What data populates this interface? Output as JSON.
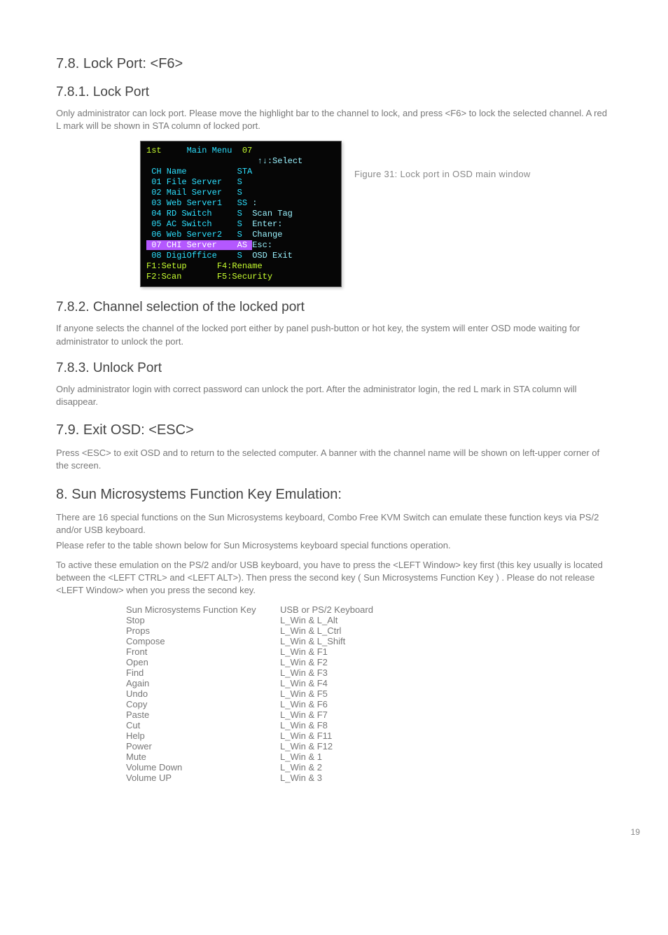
{
  "sections": {
    "h_78": "7.8. Lock Port: <F6>",
    "h_781": "7.8.1. Lock Port",
    "p_781": "Only administrator can lock port. Please move the highlight bar to the channel to lock, and press <F6> to lock the selected channel. A red L mark will be shown in STA column of locked port.",
    "fig31_caption": "Figure 31: Lock port in OSD main window",
    "h_782": "7.8.2. Channel selection of the locked port",
    "p_782": "If anyone selects the channel of the locked port either by panel push-button or hot key, the system will enter OSD mode waiting for administrator to unlock the port.",
    "h_783": "7.8.3. Unlock Port",
    "p_783": "Only administrator login with correct password can unlock the port. After the administrator login, the red L mark in STA column will disappear.",
    "h_79": "7.9. Exit OSD: <ESC>",
    "p_79": "Press <ESC> to exit OSD and to return to the selected computer. A banner with the channel name will be shown on left-upper corner of the screen.",
    "h_8": " 8. Sun Microsystems Function Key Emulation:",
    "p_8a": "There are 16 special functions on the Sun Microsystems keyboard, Combo Free KVM Switch can emulate these function keys via PS/2 and/or USB keyboard.",
    "p_8b": "Please refer to the table shown below for Sun Microsystems keyboard special functions operation.",
    "p_8c": "To active these emulation on the PS/2 and/or USB keyboard, you have to press the <LEFT Window> key first (this key usually is located between the <LEFT CTRL> and <LEFT ALT>). Then press the second key ( Sun Microsystems Function Key ) . Please do not release <LEFT Window> when you press the second key."
  },
  "osd": {
    "title_left": "1st",
    "title_center": "Main Menu",
    "title_right": "07",
    "select_hint": "↑↓:Select",
    "col_ch": "CH",
    "col_name": "Name",
    "col_sta": "STA",
    "rows": [
      {
        "ch": "01",
        "name": "File Server",
        "sta": "S"
      },
      {
        "ch": "02",
        "name": "Mail Server",
        "sta": "S"
      },
      {
        "ch": "03",
        "name": "Web Server1",
        "sta": "SS"
      },
      {
        "ch": "04",
        "name": "RD Switch",
        "sta": "S"
      },
      {
        "ch": "05",
        "name": "AC Switch",
        "sta": "S"
      },
      {
        "ch": "06",
        "name": "Web Server2",
        "sta": "S"
      },
      {
        "ch": "07",
        "name": "CHI Server",
        "sta": "AS",
        "hi": true
      },
      {
        "ch": "08",
        "name": "DigiOffice",
        "sta": "S"
      }
    ],
    "help": [
      ":",
      "Scan Tag",
      "Enter:",
      "Change",
      "Esc:",
      "OSD Exit"
    ],
    "footer": {
      "f1": "F1:Setup",
      "f4": "F4:Rename",
      "f2": "F2:Scan",
      "f5": "F5:Security"
    }
  },
  "keytable": {
    "header": {
      "c1": "Sun Microsystems Function Key",
      "c2": "USB or PS/2 Keyboard"
    },
    "rows": [
      {
        "c1": "Stop",
        "c2": "L_Win & L_Alt"
      },
      {
        "c1": "Props",
        "c2": "L_Win & L_Ctrl"
      },
      {
        "c1": "Compose",
        "c2": "L_Win & L_Shift"
      },
      {
        "c1": "Front",
        "c2": "L_Win & F1"
      },
      {
        "c1": "Open",
        "c2": "L_Win & F2"
      },
      {
        "c1": "Find",
        "c2": "L_Win & F3"
      },
      {
        "c1": "Again",
        "c2": "L_Win & F4"
      },
      {
        "c1": "Undo",
        "c2": "L_Win & F5"
      },
      {
        "c1": "Copy",
        "c2": "L_Win & F6"
      },
      {
        "c1": "Paste",
        "c2": "L_Win & F7"
      },
      {
        "c1": "Cut",
        "c2": "L_Win & F8"
      },
      {
        "c1": "Help",
        "c2": "L_Win & F11"
      },
      {
        "c1": "Power",
        "c2": "L_Win & F12"
      },
      {
        "c1": "Mute",
        "c2": "L_Win & 1"
      },
      {
        "c1": "Volume Down",
        "c2": "L_Win & 2"
      },
      {
        "c1": "Volume UP",
        "c2": "L_Win & 3"
      }
    ]
  },
  "page_number": "19"
}
